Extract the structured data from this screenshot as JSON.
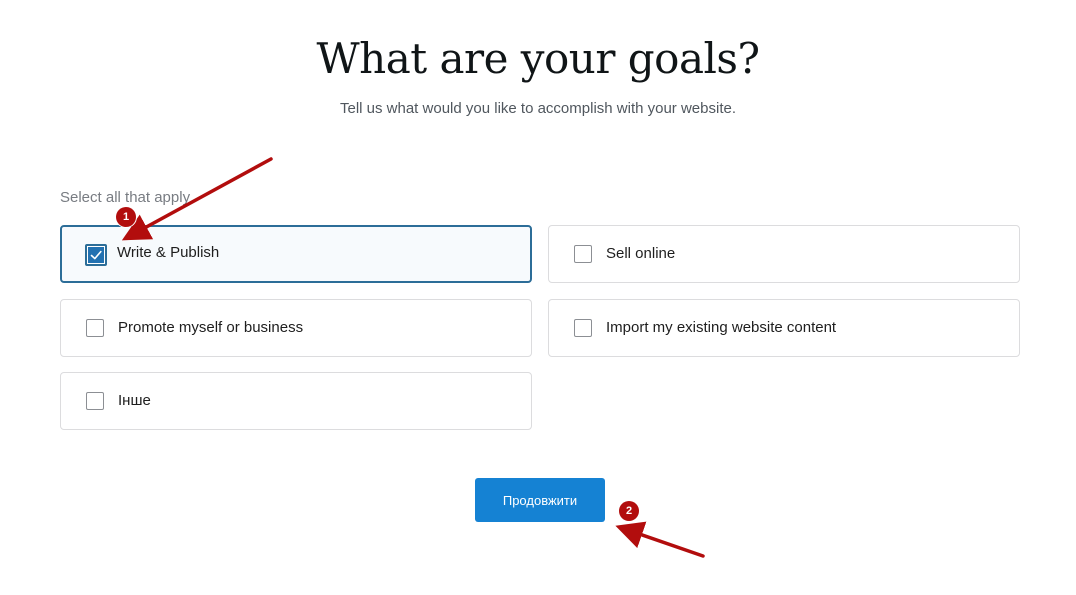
{
  "header": {
    "title": "What are your goals?",
    "subtitle": "Tell us what would you like to accomplish with your website."
  },
  "options": {
    "hint": "Select all that apply",
    "items": [
      {
        "label": "Write & Publish",
        "checked": true
      },
      {
        "label": "Sell online",
        "checked": false
      },
      {
        "label": "Promote myself or business",
        "checked": false
      },
      {
        "label": "Import my existing website content",
        "checked": false
      },
      {
        "label": "Інше",
        "checked": false
      }
    ]
  },
  "actions": {
    "continue_label": "Продовжити"
  },
  "annotations": {
    "badge_1": "1",
    "badge_2": "2",
    "color": "#b20d0d"
  },
  "colors": {
    "accent": "#1582d3",
    "selected_border": "#2c6d98",
    "checkbox_fill": "#2271b1"
  }
}
